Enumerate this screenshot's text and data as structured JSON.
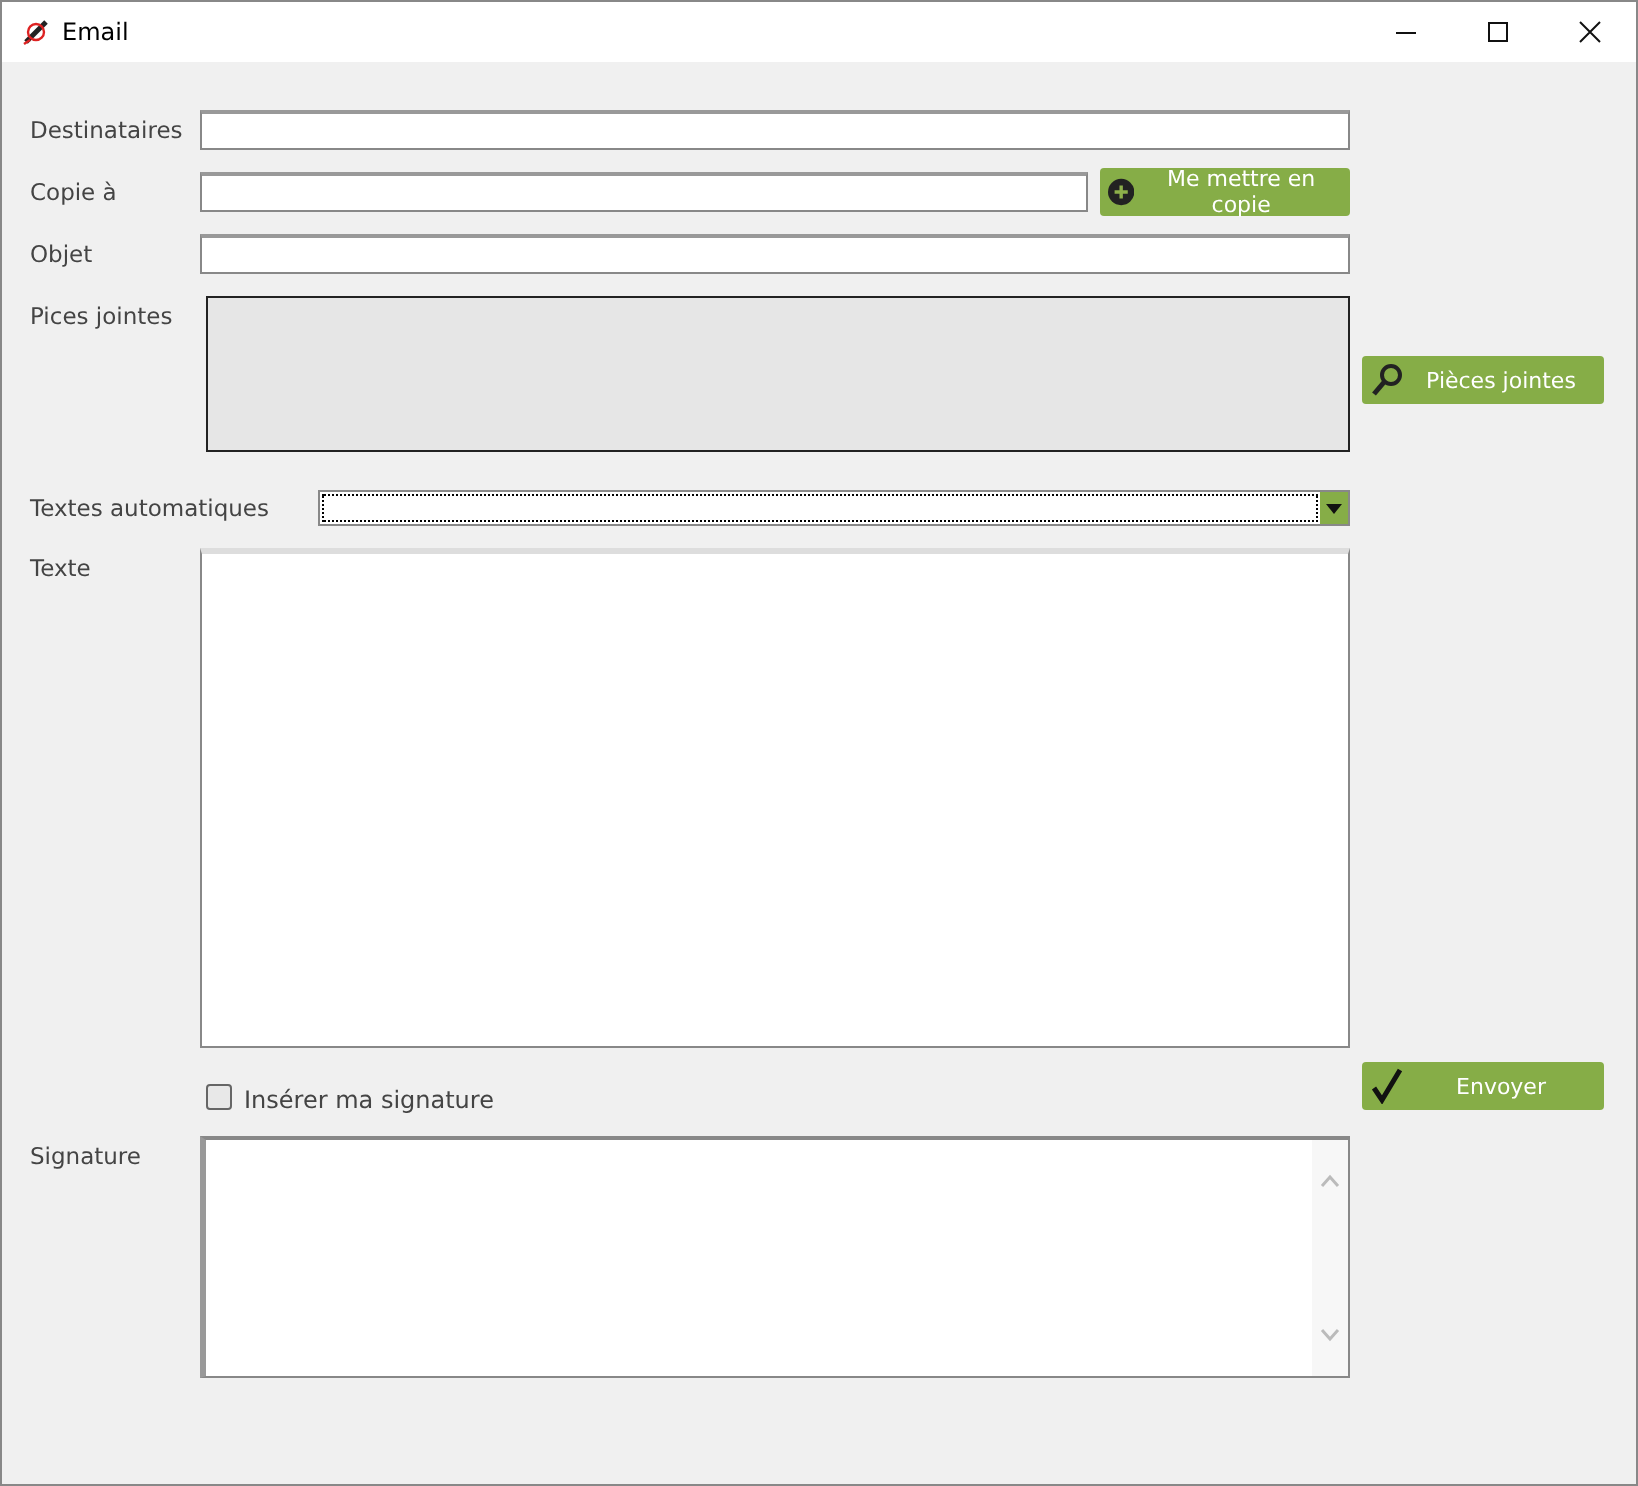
{
  "window": {
    "title": "Email"
  },
  "fields": [
    {
      "label": "Destinataires",
      "kind": "line"
    },
    {
      "label": "Copie à",
      "kind": "line-button",
      "button": "Me mettre en copie"
    },
    {
      "label": "Objet",
      "kind": "line"
    },
    {
      "label": "Pices jointes",
      "kind": "attachments",
      "button": "Pièces jointes"
    },
    {
      "label": "Textes automatiques",
      "kind": "combo"
    },
    {
      "label": "Texte",
      "kind": "text"
    }
  ],
  "signature_checkbox": {
    "label": "Insérer ma signature",
    "checked": false
  },
  "send_button": "Envoyer",
  "signature": {
    "label": "Signature"
  }
}
